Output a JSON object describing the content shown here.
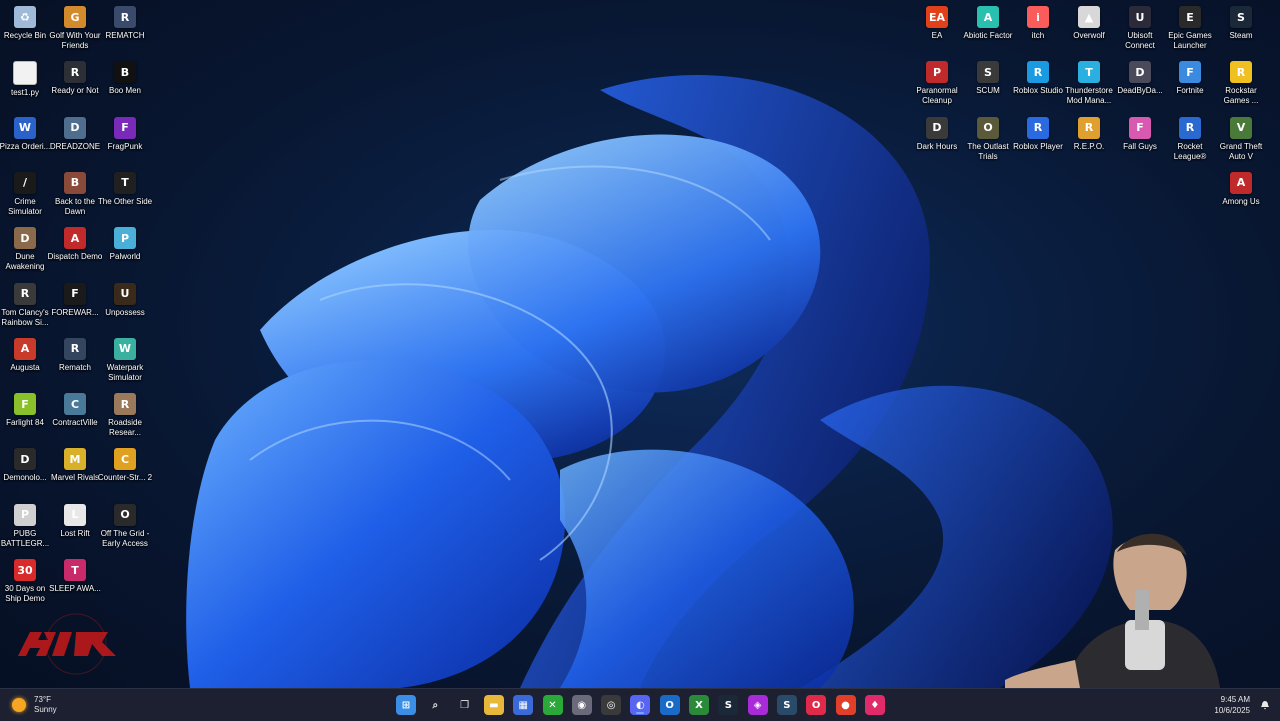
{
  "desktop": {
    "left_icons": [
      {
        "label": "Recycle Bin",
        "icon": "recycle-bin-icon",
        "color": "#9fb9d8",
        "glyph": "♻"
      },
      {
        "label": "Golf With Your Friends",
        "icon": "golf-icon",
        "color": "#d28a2c",
        "glyph": "G"
      },
      {
        "label": "REMATCH",
        "icon": "rematch-icon",
        "color": "#3a4a6a",
        "glyph": "R"
      },
      {
        "label": "test1.py",
        "icon": "file-icon",
        "color": "#f2f2f2",
        "glyph": ""
      },
      {
        "label": "Ready or Not",
        "icon": "ready-or-not-icon",
        "color": "#2c2f36",
        "glyph": "R"
      },
      {
        "label": "Boo Men",
        "icon": "boo-men-icon",
        "color": "#111111",
        "glyph": "B"
      },
      {
        "label": "Pizza Orderi...",
        "icon": "word-doc-icon",
        "color": "#2b62c9",
        "glyph": "W"
      },
      {
        "label": "DREADZONE",
        "icon": "dreadzone-icon",
        "color": "#4f6d8c",
        "glyph": "D"
      },
      {
        "label": "FragPunk",
        "icon": "fragpunk-icon",
        "color": "#7a2ab8",
        "glyph": "F"
      },
      {
        "label": "Crime Simulator",
        "icon": "crime-simulator-icon",
        "color": "#1a1a1a",
        "glyph": "/"
      },
      {
        "label": "Back to the Dawn",
        "icon": "back-to-the-dawn-icon",
        "color": "#8a4a3a",
        "glyph": "B"
      },
      {
        "label": "The Other Side",
        "icon": "the-other-side-icon",
        "color": "#202020",
        "glyph": "T"
      },
      {
        "label": "Dune Awakening",
        "icon": "dune-awakening-icon",
        "color": "#8a6a4a",
        "glyph": "D"
      },
      {
        "label": "Dispatch Demo",
        "icon": "dispatch-icon",
        "color": "#c02a2a",
        "glyph": "A"
      },
      {
        "label": "Palworld",
        "icon": "palworld-icon",
        "color": "#4ab0d8",
        "glyph": "P"
      },
      {
        "label": "Tom Clancy's Rainbow Si...",
        "icon": "rainbow-six-icon",
        "color": "#3a3a3a",
        "glyph": "R"
      },
      {
        "label": "FOREWAR...",
        "icon": "forewarned-icon",
        "color": "#1a1a1a",
        "glyph": "F"
      },
      {
        "label": "Unpossess",
        "icon": "unpossess-icon",
        "color": "#3a2a1a",
        "glyph": "U"
      },
      {
        "label": "Augusta",
        "icon": "augusta-icon",
        "color": "#c83a2a",
        "glyph": "A"
      },
      {
        "label": "Rematch",
        "icon": "rematch-shortcut-icon",
        "color": "#34455f",
        "glyph": "R"
      },
      {
        "label": "Waterpark Simulator",
        "icon": "waterpark-icon",
        "color": "#3ab0a0",
        "glyph": "W"
      },
      {
        "label": "Farlight 84",
        "icon": "farlight-icon",
        "color": "#8ac02a",
        "glyph": "F"
      },
      {
        "label": "ContractVille",
        "icon": "contractville-icon",
        "color": "#4a7a9a",
        "glyph": "C"
      },
      {
        "label": "Roadside Resear...",
        "icon": "roadside-research-icon",
        "color": "#9a7a5a",
        "glyph": "R"
      },
      {
        "label": "Demonolo...",
        "icon": "demonologist-icon",
        "color": "#2a2a2a",
        "glyph": "D"
      },
      {
        "label": "Marvel Rivals",
        "icon": "marvel-rivals-icon",
        "color": "#d8b02a",
        "glyph": "M"
      },
      {
        "label": "Counter-Str... 2",
        "icon": "counter-strike-icon",
        "color": "#e0a020",
        "glyph": "C"
      },
      {
        "label": "PUBG BATTLEGR...",
        "icon": "pubg-icon",
        "color": "#d0d0d0",
        "glyph": "P"
      },
      {
        "label": "Lost Rift",
        "icon": "lost-rift-icon",
        "color": "#e8e8e8",
        "glyph": "L"
      },
      {
        "label": "Off The Grid - Early Access",
        "icon": "off-the-grid-icon",
        "color": "#2a2a2a",
        "glyph": "O"
      },
      {
        "label": "30 Days on Ship Demo",
        "icon": "30-days-on-ship-icon",
        "color": "#d82a2a",
        "glyph": "30"
      },
      {
        "label": "SLEEP AWA...",
        "icon": "sleep-awake-icon",
        "color": "#c82a6a",
        "glyph": "T"
      }
    ],
    "right_icons": [
      {
        "label": "EA",
        "icon": "ea-icon",
        "color": "#e0401a",
        "glyph": "EA"
      },
      {
        "label": "Abiotic Factor",
        "icon": "abiotic-factor-icon",
        "color": "#2ac0b0",
        "glyph": "A"
      },
      {
        "label": "itch",
        "icon": "itch-icon",
        "color": "#fa5c5c",
        "glyph": "i"
      },
      {
        "label": "Overwolf",
        "icon": "overwolf-icon",
        "color": "#d8d8d8",
        "glyph": "▲"
      },
      {
        "label": "Ubisoft Connect",
        "icon": "ubisoft-icon",
        "color": "#2a2a3a",
        "glyph": "U"
      },
      {
        "label": "Epic Games Launcher",
        "icon": "epic-games-icon",
        "color": "#2a2a2a",
        "glyph": "E"
      },
      {
        "label": "Steam",
        "icon": "steam-icon",
        "color": "#1b2838",
        "glyph": "S"
      },
      {
        "label": "Paranormal Cleanup",
        "icon": "paranormal-cleanup-icon",
        "color": "#c02a2a",
        "glyph": "P"
      },
      {
        "label": "SCUM",
        "icon": "scum-icon",
        "color": "#3a3a3a",
        "glyph": "S"
      },
      {
        "label": "Roblox Studio",
        "icon": "roblox-studio-icon",
        "color": "#1a9ae0",
        "glyph": "R"
      },
      {
        "label": "Thunderstore Mod Mana...",
        "icon": "thunderstore-icon",
        "color": "#2ab0e0",
        "glyph": "T"
      },
      {
        "label": "DeadByDa...",
        "icon": "dead-by-daylight-icon",
        "color": "#4a4a5a",
        "glyph": "D"
      },
      {
        "label": "Fortnite",
        "icon": "fortnite-icon",
        "color": "#3a8ae0",
        "glyph": "F"
      },
      {
        "label": "Rockstar Games ...",
        "icon": "rockstar-icon",
        "color": "#f0c020",
        "glyph": "R"
      },
      {
        "label": "Dark Hours",
        "icon": "dark-hours-icon",
        "color": "#3a3a3a",
        "glyph": "D"
      },
      {
        "label": "The Outlast Trials",
        "icon": "outlast-trials-icon",
        "color": "#5a5a3a",
        "glyph": "O"
      },
      {
        "label": "Roblox Player",
        "icon": "roblox-player-icon",
        "color": "#2a6ae0",
        "glyph": "R"
      },
      {
        "label": "R.E.P.O.",
        "icon": "repo-icon",
        "color": "#e0a030",
        "glyph": "R"
      },
      {
        "label": "Fall Guys",
        "icon": "fall-guys-icon",
        "color": "#d85ab0",
        "glyph": "F"
      },
      {
        "label": "Rocket League®",
        "icon": "rocket-league-icon",
        "color": "#2a6ad0",
        "glyph": "R"
      },
      {
        "label": "Grand Theft Auto V",
        "icon": "gta-v-icon",
        "color": "#4a7a3a",
        "glyph": "V"
      },
      {
        "label": "Among Us",
        "icon": "among-us-icon",
        "color": "#c02a2a",
        "glyph": "A"
      }
    ]
  },
  "taskbar": {
    "weather": {
      "temp": "73°F",
      "condition": "Sunny",
      "icon": "sun-icon"
    },
    "items": [
      {
        "name": "start-button",
        "icon": "windows-logo-icon",
        "color": "#3a8ee6",
        "glyph": "⊞",
        "active": false
      },
      {
        "name": "search-button",
        "icon": "search-icon",
        "color": "transparent",
        "glyph": "⌕",
        "active": false
      },
      {
        "name": "task-view-button",
        "icon": "task-view-icon",
        "color": "transparent",
        "glyph": "❐",
        "active": false
      },
      {
        "name": "file-explorer-button",
        "icon": "folder-icon",
        "color": "#e8b83a",
        "glyph": "▬",
        "active": false
      },
      {
        "name": "microsoft-store-button",
        "icon": "store-icon",
        "color": "#3a6ad8",
        "glyph": "▦",
        "active": false
      },
      {
        "name": "xbox-app-button",
        "icon": "xbox-green-icon",
        "color": "#2aa83a",
        "glyph": "✕",
        "active": false
      },
      {
        "name": "taskbar-app-button",
        "icon": "app-gray-icon",
        "color": "#6a6a7a",
        "glyph": "◉",
        "active": false
      },
      {
        "name": "obs-button",
        "icon": "obs-icon",
        "color": "#3a3a3a",
        "glyph": "◎",
        "active": false
      },
      {
        "name": "discord-button",
        "icon": "discord-icon",
        "color": "#5865f2",
        "glyph": "◐",
        "active": true
      },
      {
        "name": "outlook-button",
        "icon": "outlook-icon",
        "color": "#1a6ac8",
        "glyph": "O",
        "active": false
      },
      {
        "name": "xbox-button",
        "icon": "xbox-icon",
        "color": "#2a8a3a",
        "glyph": "X",
        "active": false
      },
      {
        "name": "steam-button",
        "icon": "steam-icon",
        "color": "#1b2838",
        "glyph": "S",
        "active": false
      },
      {
        "name": "streaming-app-button",
        "icon": "stream-app-icon",
        "color": "#a82ad8",
        "glyph": "◈",
        "active": false
      },
      {
        "name": "steam-button-2",
        "icon": "steam-icon",
        "color": "#2a4a6a",
        "glyph": "S",
        "active": false
      },
      {
        "name": "opera-gx-button",
        "icon": "opera-gx-icon",
        "color": "#e02a4a",
        "glyph": "O",
        "active": false
      },
      {
        "name": "chrome-button",
        "icon": "chrome-icon",
        "color": "#e0402a",
        "glyph": "●",
        "active": false
      },
      {
        "name": "maps-pin-button",
        "icon": "map-pin-icon",
        "color": "#e02a6a",
        "glyph": "♦",
        "active": false
      }
    ],
    "clock": {
      "time": "9:45 AM",
      "date": "10/6/2025"
    }
  }
}
